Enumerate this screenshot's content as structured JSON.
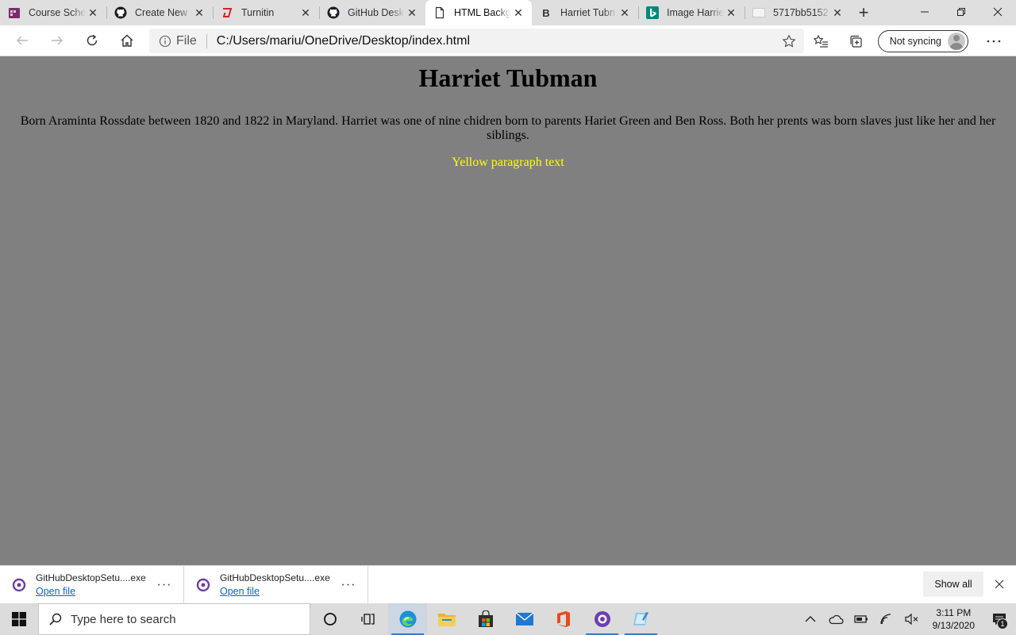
{
  "browser": {
    "tabs": [
      {
        "title": "Course Sche",
        "icon": "course-schedule-icon"
      },
      {
        "title": "Create New",
        "icon": "github-icon"
      },
      {
        "title": "Turnitin",
        "icon": "turnitin-icon"
      },
      {
        "title": "GitHub Desk",
        "icon": "github-icon"
      },
      {
        "title": "HTML Backg",
        "icon": "page-icon",
        "active": true
      },
      {
        "title": "Harriet Tubn",
        "icon": "bold-b-icon"
      },
      {
        "title": "Image Harrie",
        "icon": "bing-icon"
      },
      {
        "title": "5717bb5152",
        "icon": "image-icon"
      }
    ],
    "address": {
      "scheme_label": "File",
      "url": "C:/Users/mariu/OneDrive/Desktop/index.html"
    },
    "profile": {
      "label": "Not syncing"
    }
  },
  "page": {
    "heading": "Harriet Tubman",
    "paragraph": "Born Araminta Rossdate between 1820 and 1822 in Maryland. Harriet was one of nine chidren born to parents Hariet Green and Ben Ross. Both her prents was born slaves just like her and her siblings.",
    "yellow_text": "Yellow paragraph text",
    "background_color": "#808080",
    "yellow_color": "#ffff00"
  },
  "downloads": {
    "items": [
      {
        "name": "GitHubDesktopSetu....exe",
        "action": "Open file"
      },
      {
        "name": "GitHubDesktopSetu....exe",
        "action": "Open file"
      }
    ],
    "show_all_label": "Show all"
  },
  "taskbar": {
    "search_placeholder": "Type here to search",
    "apps": [
      "cortana-icon",
      "task-view-icon",
      "edge-icon",
      "file-explorer-icon",
      "store-icon",
      "mail-icon",
      "office-icon",
      "teams-icon",
      "paint-icon"
    ],
    "clock": {
      "time": "3:11 PM",
      "date": "9/13/2020"
    },
    "notification_count": "1"
  }
}
